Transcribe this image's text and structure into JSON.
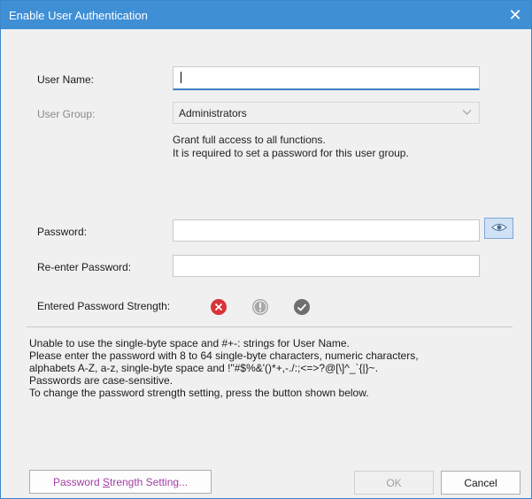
{
  "window": {
    "title": "Enable User Authentication",
    "close_glyph": "✕"
  },
  "form": {
    "user_name_label": "User Name:",
    "user_name_value": "",
    "user_group_label": "User Group:",
    "user_group_value": "Administrators",
    "group_description_line1": "Grant full access to all functions.",
    "group_description_line2": "It is required to set a password for this user group.",
    "password_label": "Password:",
    "reenter_password_label": "Re-enter Password:",
    "strength_label": "Entered Password Strength:",
    "strength_icons": [
      "error-icon",
      "warning-icon",
      "check-icon"
    ]
  },
  "notes": [
    "Unable to use the single-byte space and #+-: strings for User Name.",
    "Please enter the password with 8 to 64 single-byte characters, numeric characters,",
    "alphabets A-Z, a-z, single-byte space and !\"#$%&'()*+,-./:;<=>?@[\\]^_`{|}~.",
    "Passwords are case-sensitive.",
    "To change the password strength setting, press the button shown below."
  ],
  "buttons": {
    "strength_setting_pre": "Password ",
    "strength_setting_underlined": "S",
    "strength_setting_post": "trength Setting...",
    "ok": "OK",
    "cancel": "Cancel"
  },
  "colors": {
    "titlebar": "#3f8fd5",
    "error": "#d9333a",
    "warning": "#a8a8a8",
    "check": "#6f6f6f",
    "link_text": "#a33da3"
  }
}
